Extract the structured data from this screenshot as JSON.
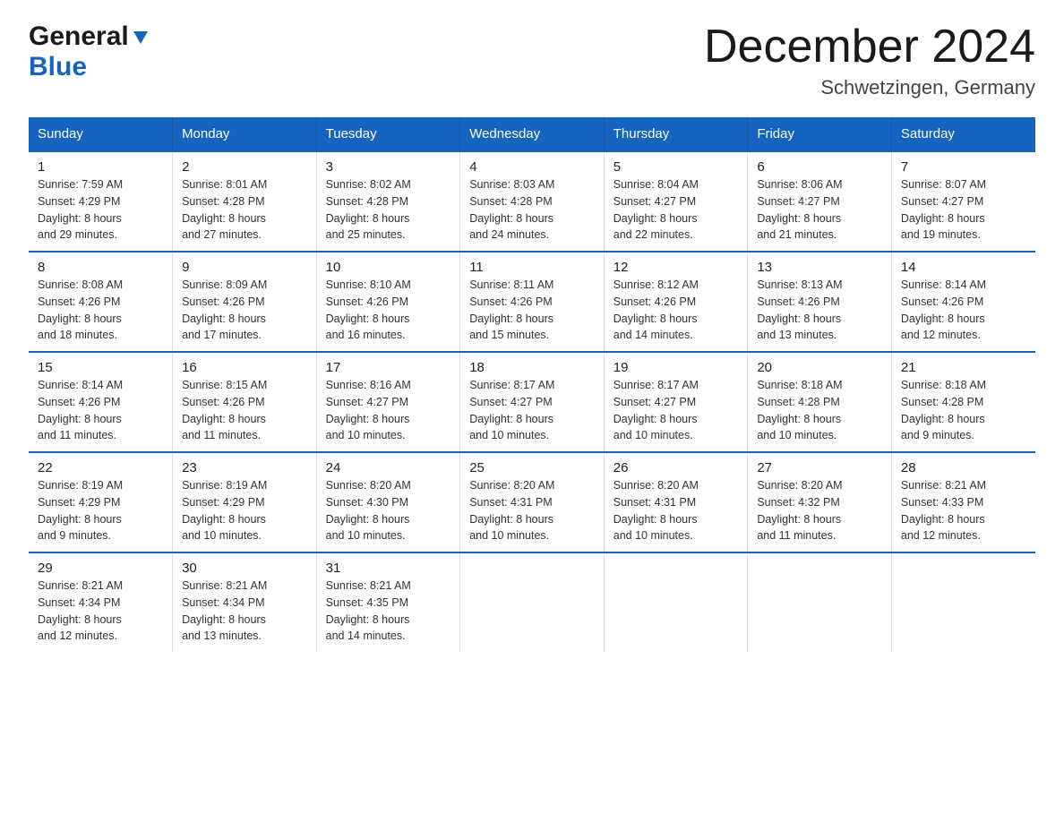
{
  "logo": {
    "general": "General",
    "blue": "Blue",
    "arrow": "▼"
  },
  "title": "December 2024",
  "subtitle": "Schwetzingen, Germany",
  "days_header": [
    "Sunday",
    "Monday",
    "Tuesday",
    "Wednesday",
    "Thursday",
    "Friday",
    "Saturday"
  ],
  "weeks": [
    [
      {
        "num": "1",
        "sunrise": "7:59 AM",
        "sunset": "4:29 PM",
        "daylight": "8 hours and 29 minutes."
      },
      {
        "num": "2",
        "sunrise": "8:01 AM",
        "sunset": "4:28 PM",
        "daylight": "8 hours and 27 minutes."
      },
      {
        "num": "3",
        "sunrise": "8:02 AM",
        "sunset": "4:28 PM",
        "daylight": "8 hours and 25 minutes."
      },
      {
        "num": "4",
        "sunrise": "8:03 AM",
        "sunset": "4:28 PM",
        "daylight": "8 hours and 24 minutes."
      },
      {
        "num": "5",
        "sunrise": "8:04 AM",
        "sunset": "4:27 PM",
        "daylight": "8 hours and 22 minutes."
      },
      {
        "num": "6",
        "sunrise": "8:06 AM",
        "sunset": "4:27 PM",
        "daylight": "8 hours and 21 minutes."
      },
      {
        "num": "7",
        "sunrise": "8:07 AM",
        "sunset": "4:27 PM",
        "daylight": "8 hours and 19 minutes."
      }
    ],
    [
      {
        "num": "8",
        "sunrise": "8:08 AM",
        "sunset": "4:26 PM",
        "daylight": "8 hours and 18 minutes."
      },
      {
        "num": "9",
        "sunrise": "8:09 AM",
        "sunset": "4:26 PM",
        "daylight": "8 hours and 17 minutes."
      },
      {
        "num": "10",
        "sunrise": "8:10 AM",
        "sunset": "4:26 PM",
        "daylight": "8 hours and 16 minutes."
      },
      {
        "num": "11",
        "sunrise": "8:11 AM",
        "sunset": "4:26 PM",
        "daylight": "8 hours and 15 minutes."
      },
      {
        "num": "12",
        "sunrise": "8:12 AM",
        "sunset": "4:26 PM",
        "daylight": "8 hours and 14 minutes."
      },
      {
        "num": "13",
        "sunrise": "8:13 AM",
        "sunset": "4:26 PM",
        "daylight": "8 hours and 13 minutes."
      },
      {
        "num": "14",
        "sunrise": "8:14 AM",
        "sunset": "4:26 PM",
        "daylight": "8 hours and 12 minutes."
      }
    ],
    [
      {
        "num": "15",
        "sunrise": "8:14 AM",
        "sunset": "4:26 PM",
        "daylight": "8 hours and 11 minutes."
      },
      {
        "num": "16",
        "sunrise": "8:15 AM",
        "sunset": "4:26 PM",
        "daylight": "8 hours and 11 minutes."
      },
      {
        "num": "17",
        "sunrise": "8:16 AM",
        "sunset": "4:27 PM",
        "daylight": "8 hours and 10 minutes."
      },
      {
        "num": "18",
        "sunrise": "8:17 AM",
        "sunset": "4:27 PM",
        "daylight": "8 hours and 10 minutes."
      },
      {
        "num": "19",
        "sunrise": "8:17 AM",
        "sunset": "4:27 PM",
        "daylight": "8 hours and 10 minutes."
      },
      {
        "num": "20",
        "sunrise": "8:18 AM",
        "sunset": "4:28 PM",
        "daylight": "8 hours and 10 minutes."
      },
      {
        "num": "21",
        "sunrise": "8:18 AM",
        "sunset": "4:28 PM",
        "daylight": "8 hours and 9 minutes."
      }
    ],
    [
      {
        "num": "22",
        "sunrise": "8:19 AM",
        "sunset": "4:29 PM",
        "daylight": "8 hours and 9 minutes."
      },
      {
        "num": "23",
        "sunrise": "8:19 AM",
        "sunset": "4:29 PM",
        "daylight": "8 hours and 10 minutes."
      },
      {
        "num": "24",
        "sunrise": "8:20 AM",
        "sunset": "4:30 PM",
        "daylight": "8 hours and 10 minutes."
      },
      {
        "num": "25",
        "sunrise": "8:20 AM",
        "sunset": "4:31 PM",
        "daylight": "8 hours and 10 minutes."
      },
      {
        "num": "26",
        "sunrise": "8:20 AM",
        "sunset": "4:31 PM",
        "daylight": "8 hours and 10 minutes."
      },
      {
        "num": "27",
        "sunrise": "8:20 AM",
        "sunset": "4:32 PM",
        "daylight": "8 hours and 11 minutes."
      },
      {
        "num": "28",
        "sunrise": "8:21 AM",
        "sunset": "4:33 PM",
        "daylight": "8 hours and 12 minutes."
      }
    ],
    [
      {
        "num": "29",
        "sunrise": "8:21 AM",
        "sunset": "4:34 PM",
        "daylight": "8 hours and 12 minutes."
      },
      {
        "num": "30",
        "sunrise": "8:21 AM",
        "sunset": "4:34 PM",
        "daylight": "8 hours and 13 minutes."
      },
      {
        "num": "31",
        "sunrise": "8:21 AM",
        "sunset": "4:35 PM",
        "daylight": "8 hours and 14 minutes."
      },
      null,
      null,
      null,
      null
    ]
  ],
  "labels": {
    "sunrise": "Sunrise:",
    "sunset": "Sunset:",
    "daylight": "Daylight:"
  }
}
